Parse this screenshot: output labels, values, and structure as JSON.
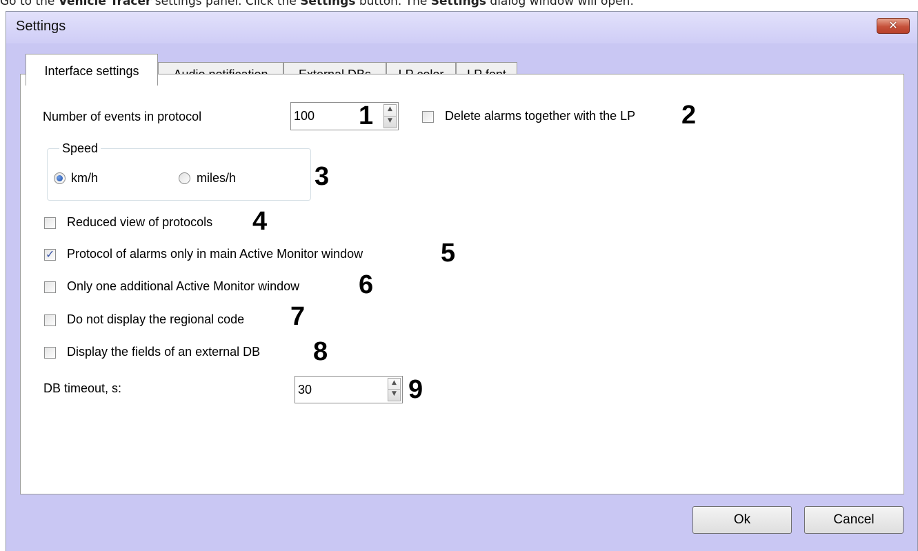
{
  "doc_line": {
    "part1": "Go to the ",
    "part2": "Vehicle Tracer",
    "part3": " settings panel. Click the ",
    "part4": "Settings",
    "part5": " button. The ",
    "part6": "Settings",
    "part7": " dialog window will open."
  },
  "window": {
    "title": "Settings",
    "close_glyph": "✕"
  },
  "tabs": [
    {
      "label": "Interface settings",
      "active": true
    },
    {
      "label": "Audio notification",
      "active": false
    },
    {
      "label": "External DBs",
      "active": false
    },
    {
      "label": "LP color",
      "active": false
    },
    {
      "label": "LP font",
      "active": false
    }
  ],
  "interface": {
    "events_label": "Number of events in protocol",
    "events_value": "100",
    "delete_alarms_label": "Delete alarms together with the LP",
    "delete_alarms_checked": false,
    "speed": {
      "title": "Speed",
      "options": [
        "km/h",
        "miles/h"
      ],
      "selected": "km/h"
    },
    "checkboxes": [
      {
        "label": "Reduced view of protocols",
        "checked": false
      },
      {
        "label": "Protocol of alarms only in main Active Monitor window",
        "checked": true
      },
      {
        "label": "Only one additional Active Monitor window",
        "checked": false
      },
      {
        "label": "Do not display the regional code",
        "checked": false
      },
      {
        "label": "Display the fields of an external DB",
        "checked": false
      }
    ],
    "timeout_label": "DB timeout, s:",
    "timeout_value": "30"
  },
  "markers": [
    "1",
    "2",
    "3",
    "4",
    "5",
    "6",
    "7",
    "8",
    "9"
  ],
  "buttons": {
    "ok": "Ok",
    "cancel": "Cancel"
  },
  "icons": {
    "spin_up": "▲",
    "spin_down": "▼",
    "check": "✓"
  },
  "colors": {
    "window_bg": "#c9c7f3",
    "close_button": "#c6523b",
    "check_accent": "#3a55a8"
  }
}
